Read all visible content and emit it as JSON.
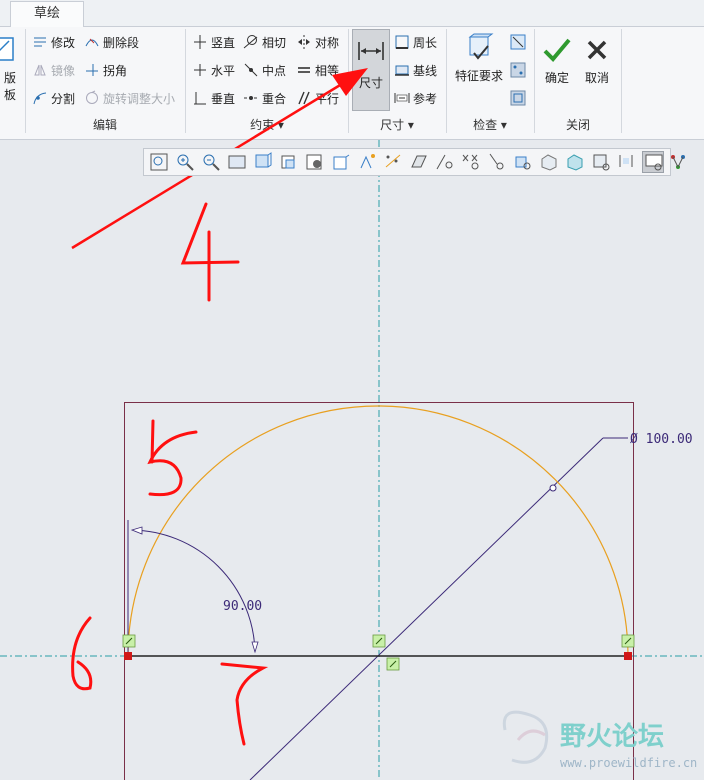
{
  "tabs": {
    "sketch": "草绘"
  },
  "ribbon": {
    "partial_left": "版板",
    "edit": {
      "modify": "修改",
      "delete_segment": "删除段",
      "mirror": "镜像",
      "corner": "拐角",
      "divide": "分割",
      "rotate_resize": "旋转调整大小",
      "group": "编辑"
    },
    "constrain": {
      "vertical": "竖直",
      "tangent": "相切",
      "symmetric": "对称",
      "horizontal": "水平",
      "midpoint": "中点",
      "equal": "相等",
      "perpendicular": "垂直",
      "coincident": "重合",
      "parallel": "平行",
      "group": "约束 ▾"
    },
    "dimension": {
      "normal": "尺寸",
      "perimeter": "周长",
      "baseline": "基线",
      "reference": "参考",
      "group": "尺寸 ▾"
    },
    "inspect": {
      "feature_requirements": "特征要求",
      "group": "检查 ▾"
    },
    "close": {
      "ok": "确定",
      "cancel": "取消",
      "group": "关闭"
    }
  },
  "view_toolbar": {
    "icons": [
      "refit-icon",
      "zoom-in-icon",
      "zoom-out-icon",
      "repaint-icon",
      "display-style-icon",
      "saved-orientations-icon",
      "view-manager-icon",
      "perspective-icon",
      "spin-center-icon",
      "annotation-display-icon",
      "sketch-view-icon",
      "dim-display-icon",
      "constraint-display-icon",
      "grid-display-icon",
      "vertex-display-icon",
      "shade-closed-icon",
      "overlapping-icon",
      "solid-icon",
      "dimension-lock-icon",
      "sketcher-display-icon",
      "diagnostics-icon"
    ],
    "selected_index": 19
  },
  "sketch": {
    "diameter_label": "Ø  100.00",
    "angle_label": "90.00",
    "colors": {
      "arc": "#e8a020",
      "dims": "#3c2a78",
      "box": "#7a3048",
      "centerline": "#2a9fa6",
      "vertex": "#d01818",
      "annotation": "#ff1010"
    }
  },
  "annotations": [
    "4",
    "5",
    "6",
    "7"
  ],
  "watermark": {
    "text": "野火论坛",
    "url": "www.proewildfire.cn"
  }
}
